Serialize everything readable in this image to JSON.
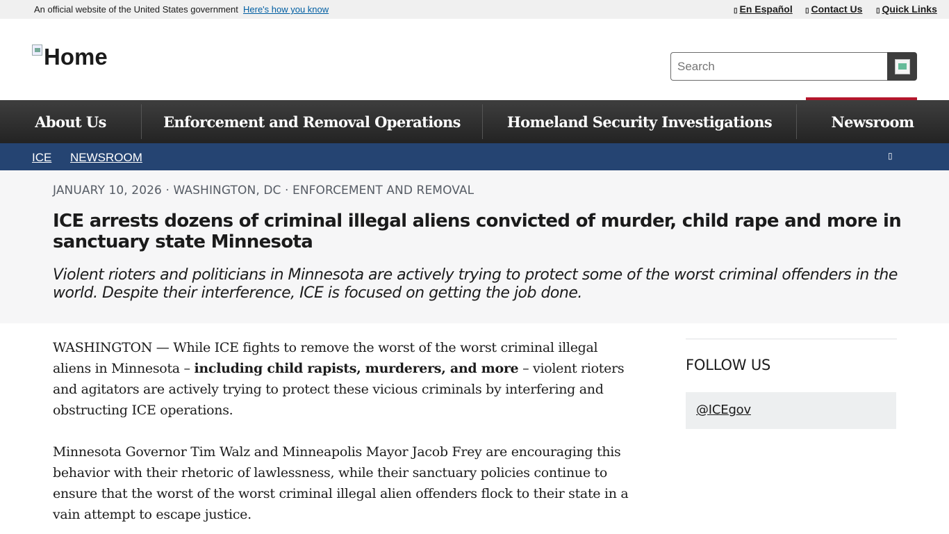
{
  "gov_banner": {
    "official_text": "An official website of the United States government",
    "how_you_know": "Here's how you know",
    "links": [
      {
        "label": "En Español",
        "glyph": "▯"
      },
      {
        "label": "Contact Us",
        "glyph": "▯"
      },
      {
        "label": "Quick Links",
        "glyph": "▯"
      }
    ]
  },
  "header": {
    "logo_alt": "Home",
    "search": {
      "placeholder": "Search"
    }
  },
  "nav": {
    "items": [
      {
        "label": "About Us"
      },
      {
        "label": "Enforcement and Removal Operations"
      },
      {
        "label": "Homeland Security Investigations"
      },
      {
        "label": "Newsroom"
      }
    ]
  },
  "breadcrumb": {
    "items": [
      {
        "label": "ICE"
      },
      {
        "label": "NEWSROOM"
      }
    ],
    "share_glyph": "▯"
  },
  "article": {
    "meta": "JANUARY 10, 2026 · WASHINGTON, DC · ENFORCEMENT AND REMOVAL",
    "title": "ICE arrests dozens of criminal illegal aliens convicted of murder, child rape and more in sanctuary state Minnesota",
    "subtitle": "Violent rioters and politicians in Minnesota are actively trying to protect some of the worst criminal offenders in the world. Despite their interference, ICE is focused on getting the job done.",
    "p1_a": "WASHINGTON — While ICE fights to remove the worst of the worst criminal illegal aliens in Minnesota – ",
    "p1_bold": "including child rapists, murderers, and more",
    "p1_b": " – violent rioters and agitators are actively trying to protect these vicious criminals by interfering and obstructing ICE operations.",
    "p2": "Minnesota Governor Tim Walz and Minneapolis Mayor Jacob Frey are encouraging this behavior with their rhetoric of lawlessness, while their sanctuary policies continue to ensure that the worst of the worst criminal illegal alien offenders flock to their state in a vain attempt to escape justice."
  },
  "sidebar": {
    "follow_title": "FOLLOW US",
    "follow_handle": "@ICEgov"
  }
}
